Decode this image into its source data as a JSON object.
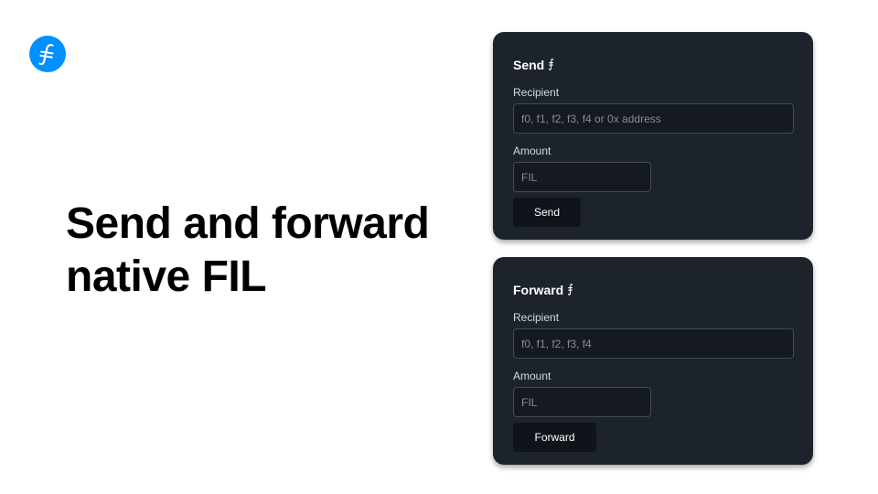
{
  "brand": {
    "logo_icon": "filecoin-logo-icon",
    "logo_color": "#0090ff"
  },
  "headline": "Send and forward native FIL",
  "send_card": {
    "title": "Send",
    "title_icon": "⨎",
    "recipient_label": "Recipient",
    "recipient_placeholder": "f0, f1, f2, f3, f4 or 0x address",
    "recipient_value": "",
    "amount_label": "Amount",
    "amount_placeholder": "FIL",
    "amount_value": "",
    "button_label": "Send"
  },
  "forward_card": {
    "title": "Forward",
    "title_icon": "⨎",
    "recipient_label": "Recipient",
    "recipient_placeholder": "f0, f1, f2, f3, f4",
    "recipient_value": "",
    "amount_label": "Amount",
    "amount_placeholder": "FIL",
    "amount_value": "",
    "button_label": "Forward"
  },
  "colors": {
    "card_background": "#1d232b",
    "input_background": "#151a20",
    "button_background": "#10141a",
    "text_primary": "#ffffff"
  }
}
